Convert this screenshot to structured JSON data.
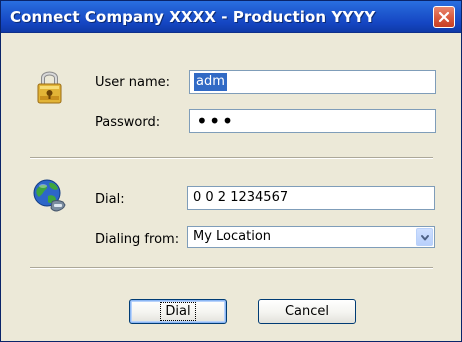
{
  "window": {
    "title": "Connect Company XXXX - Production YYYY"
  },
  "login": {
    "user_name_label": "User name:",
    "user_name_value": "adm",
    "password_label": "Password:",
    "password_value": "•••"
  },
  "dial": {
    "dial_label": "Dial:",
    "dial_value": "0 0 2 1234567",
    "dialing_from_label": "Dialing from:",
    "dialing_from_value": "My Location"
  },
  "buttons": {
    "dial_label": "Dial",
    "cancel_label": "Cancel"
  },
  "icons": {
    "close": "close-icon",
    "padlock": "padlock-icon",
    "globe": "globe-phone-icon",
    "dropdown": "chevron-down-icon"
  },
  "colors": {
    "title_bar": "#1f5ad0",
    "dialog_bg": "#ece9d8",
    "field_border": "#7f9db9",
    "selection": "#316ac5",
    "close_button": "#d9593d"
  }
}
